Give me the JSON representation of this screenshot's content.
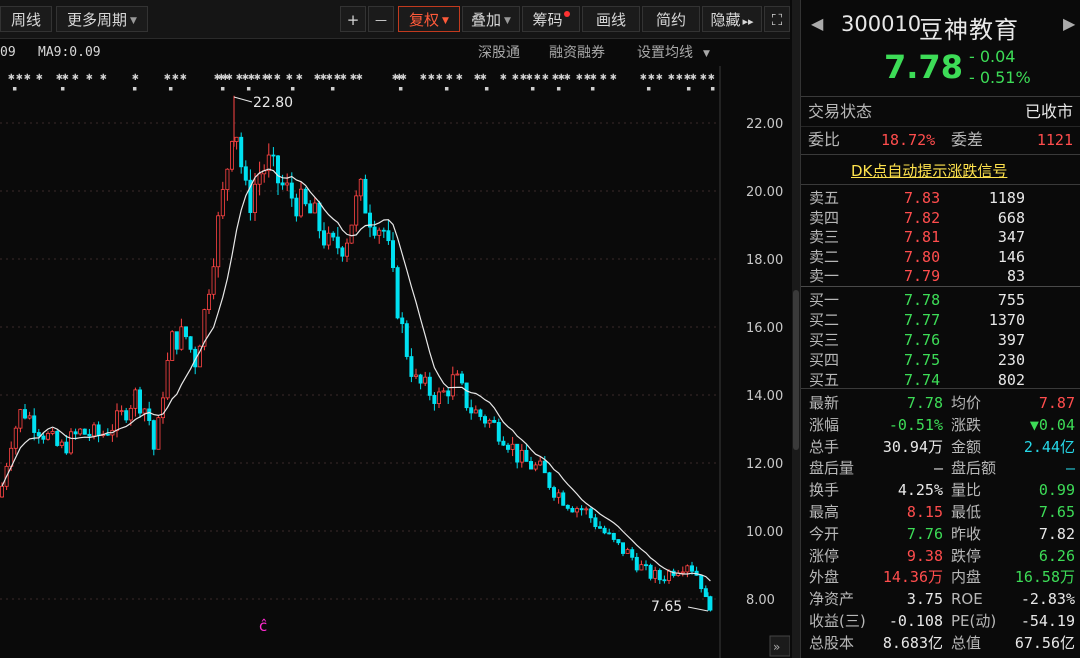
{
  "toolbar": {
    "week_line": "周线",
    "more_periods": "更多周期",
    "zoom_in": "+",
    "zoom_out": "—",
    "adjust": "复权",
    "overlay": "叠加",
    "chips": "筹码",
    "draw": "画线",
    "simple": "简约",
    "hide": "隐藏",
    "hide_arrow": "▸▸",
    "fullscreen": "⛶"
  },
  "indicator_bar": {
    "ma_left": "09",
    "ma9": "MA9:0.09",
    "shenzhen_connect": "深股通",
    "margin_trading": "融资融券",
    "ma_settings": "设置均线"
  },
  "chart_labels": {
    "high_label": "22.80",
    "low_label": "7.65",
    "marker": "ĉ"
  },
  "chart_data": {
    "type": "candlestick",
    "ylim": [
      7.3,
      23.4
    ],
    "yticks": [
      "22.00",
      "20.00",
      "18.00",
      "16.00",
      "14.00",
      "12.00",
      "10.00",
      "8.00"
    ],
    "ytick_values": [
      22,
      20,
      18,
      16,
      14,
      12,
      10,
      8
    ],
    "high": 22.8,
    "low": 7.65,
    "up_color": "#ff4444",
    "down_color": "#00e0f0",
    "ma_color": "#e8e8e8"
  },
  "quote": {
    "code": "300010",
    "name": "豆神教育",
    "price": "7.78",
    "change": "- 0.04",
    "change_pct": "- 0.51%",
    "status_label": "交易状态",
    "status_value": "已收市",
    "weibi_label": "委比",
    "weibi_value": "18.72%",
    "weicha_label": "委差",
    "weicha_value": "1121",
    "dk_link": "DK点自动提示涨跌信号"
  },
  "order_book": {
    "asks": [
      {
        "label": "卖五",
        "price": "7.83",
        "vol": "1189"
      },
      {
        "label": "卖四",
        "price": "7.82",
        "vol": "668"
      },
      {
        "label": "卖三",
        "price": "7.81",
        "vol": "347"
      },
      {
        "label": "卖二",
        "price": "7.80",
        "vol": "146"
      },
      {
        "label": "卖一",
        "price": "7.79",
        "vol": "83"
      }
    ],
    "bids": [
      {
        "label": "买一",
        "price": "7.78",
        "vol": "755"
      },
      {
        "label": "买二",
        "price": "7.77",
        "vol": "1370"
      },
      {
        "label": "买三",
        "price": "7.76",
        "vol": "397"
      },
      {
        "label": "买四",
        "price": "7.75",
        "vol": "230"
      },
      {
        "label": "买五",
        "price": "7.74",
        "vol": "802"
      }
    ]
  },
  "stats": [
    {
      "l1": "最新",
      "v1": "7.78",
      "c1": "green",
      "l2": "均价",
      "v2": "7.87",
      "c2": "red"
    },
    {
      "l1": "涨幅",
      "v1": "-0.51%",
      "c1": "green",
      "l2": "涨跌",
      "v2": "▼0.04",
      "c2": "green"
    },
    {
      "l1": "总手",
      "v1": "30.94万",
      "c1": "white",
      "l2": "金额",
      "v2": "2.44亿",
      "c2": "cyan"
    },
    {
      "l1": "盘后量",
      "v1": "—",
      "c1": "white",
      "l2": "盘后额",
      "v2": "—",
      "c2": "cyan"
    },
    {
      "l1": "换手",
      "v1": "4.25%",
      "c1": "white",
      "l2": "量比",
      "v2": "0.99",
      "c2": "green"
    },
    {
      "l1": "最高",
      "v1": "8.15",
      "c1": "red",
      "l2": "最低",
      "v2": "7.65",
      "c2": "green"
    },
    {
      "l1": "今开",
      "v1": "7.76",
      "c1": "green",
      "l2": "昨收",
      "v2": "7.82",
      "c2": "white"
    },
    {
      "l1": "涨停",
      "v1": "9.38",
      "c1": "red",
      "l2": "跌停",
      "v2": "6.26",
      "c2": "green"
    },
    {
      "l1": "外盘",
      "v1": "14.36万",
      "c1": "red",
      "l2": "内盘",
      "v2": "16.58万",
      "c2": "green"
    },
    {
      "l1": "净资产",
      "v1": "3.75",
      "c1": "white",
      "l2": "ROE",
      "v2": "-2.83%",
      "c2": "white"
    },
    {
      "l1": "收益(三)",
      "v1": "-0.108",
      "c1": "white",
      "l2": "PE(动)",
      "v2": "-54.19",
      "c2": "white"
    },
    {
      "l1": "总股本",
      "v1": "8.683亿",
      "c1": "white",
      "l2": "总值",
      "v2": "67.56亿",
      "c2": "white"
    }
  ],
  "colors": {
    "up": "#ff4444",
    "down": "#00e0f0",
    "accent": "#ff5a3a",
    "background": "#0a0a0a"
  }
}
